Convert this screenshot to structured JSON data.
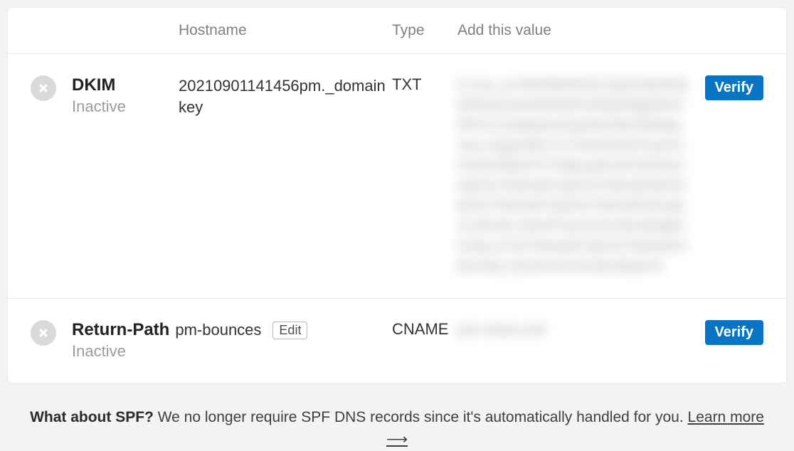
{
  "headers": {
    "hostname": "Hostname",
    "type": "Type",
    "value": "Add this value"
  },
  "rows": [
    {
      "name": "DKIM",
      "status": "Inactive",
      "hostname": "20210901141456pm._domainkey",
      "type": "TXT",
      "value_placeholder": "k=rsa; p=MIGfMA0GCSqGSIb3DQEBAQUAA4GNADCBiQKBgQDwIRP/UC3SBsEmGqZ9ZJW3/DkMoGeLnQg1fWn7/zYtIxN2SnFCjxOCKG9v3b4jYfcTNqkcyjKxOCKG9v3b4jYfcTNh43FC8jYfcTNh43F8jYfC8jYfcTNh43FC8jYfcTNh43FhKcdksLSDJKLSDsFCjxOCKG9v3b4j8SDJKLSYfcTNh43FC8jYfcTNh43FC8cC8cLSDJKxOCKG9v3b4jYfc",
      "verify_label": "Verify"
    },
    {
      "name": "Return-Path",
      "status": "Inactive",
      "hostname": "pm-bounces",
      "edit_label": "Edit",
      "type": "CNAME",
      "value_placeholder": "pm.mtasv.net",
      "verify_label": "Verify"
    }
  ],
  "footer": {
    "bold": "What about SPF?",
    "text": " We no longer require SPF DNS records since it's automatically handled for you. ",
    "link": "Learn more",
    "arrow": "⟶"
  }
}
